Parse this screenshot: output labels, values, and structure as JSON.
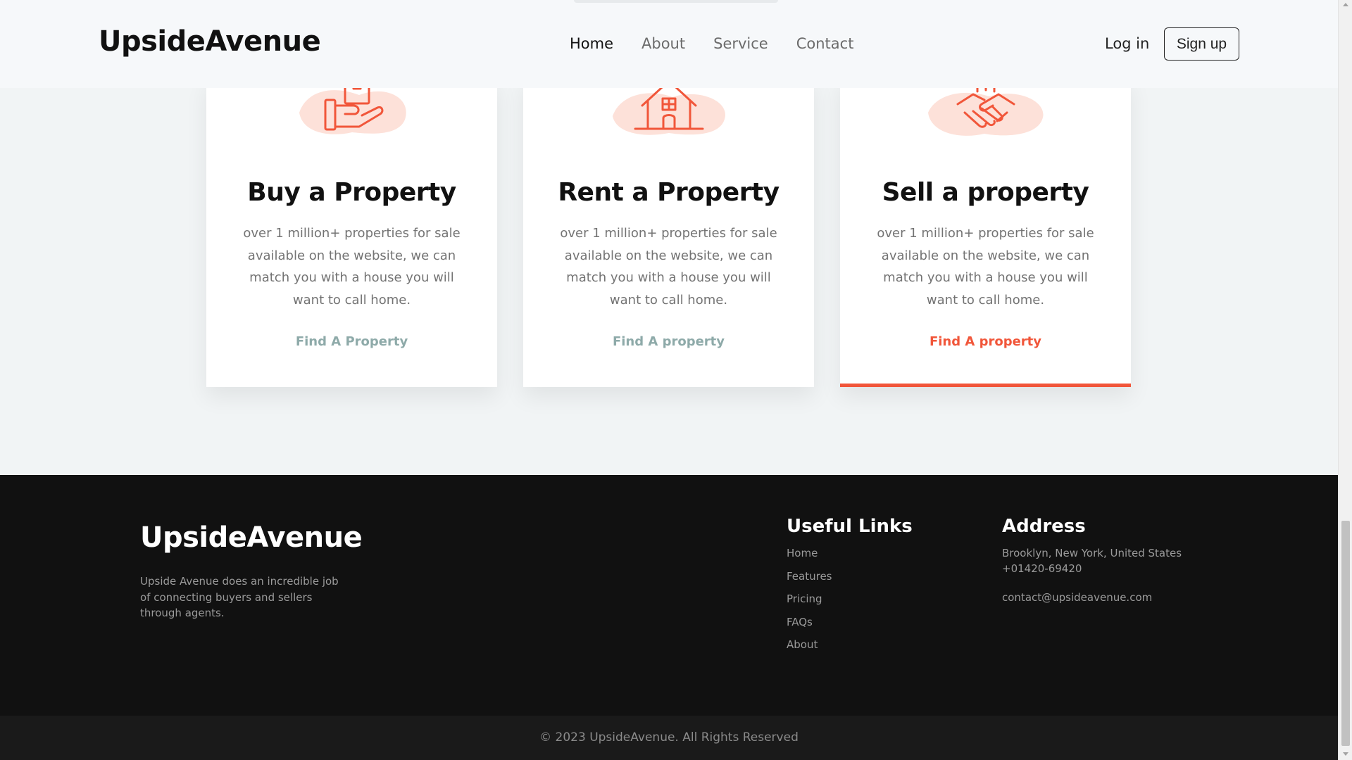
{
  "header": {
    "brand": "UpsideAvenue",
    "nav": [
      "Home",
      "About",
      "Service",
      "Contact"
    ],
    "active_nav": "Home",
    "login": "Log in",
    "signup": "Sign up"
  },
  "cards": [
    {
      "icon": "hand-holding-box-icon",
      "title": "Buy a Property",
      "text": "over 1 million+ properties for sale available on the website, we can match you with a house you will want to call home.",
      "link": "Find A Property"
    },
    {
      "icon": "house-icon",
      "title": "Rent a Property",
      "text": "over 1 million+ properties for sale available on the website, we can match you with a house you will want to call home.",
      "link": "Find A property"
    },
    {
      "icon": "handshake-icon",
      "title": "Sell a property",
      "text": "over 1 million+ properties for sale available on the website, we can match you with a house you will want to call home.",
      "link": "Find A property"
    }
  ],
  "footer": {
    "brand": "UpsideAvenue",
    "description": "Upside Avenue does an incredible job of connecting buyers and sellers through agents.",
    "useful_links_title": "Useful Links",
    "useful_links": [
      "Home",
      "Features",
      "Pricing",
      "FAQs",
      "About"
    ],
    "address_title": "Address",
    "address_line1": "Brooklyn, New York, United States",
    "address_line2": "+01420-69420",
    "email": "contact@upsideavenue.com",
    "copyright": "© 2023 UpsideAvenue. All Rights Reserved"
  },
  "colors": {
    "accent": "#f1563a",
    "link_muted": "#8eaaa9",
    "footer_bg": "#111111",
    "page_bg": "#f1f4f5"
  }
}
